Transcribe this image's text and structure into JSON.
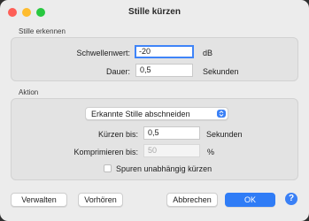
{
  "window": {
    "title": "Stille kürzen"
  },
  "detect": {
    "section_label": "Stille erkennen",
    "threshold_label": "Schwellenwert:",
    "threshold_value": "-20",
    "threshold_unit": "dB",
    "duration_label": "Dauer:",
    "duration_value": "0,5",
    "duration_unit": "Sekunden"
  },
  "action": {
    "section_label": "Aktion",
    "mode_selected": "Erkannte Stille abschneiden",
    "truncate_label": "Kürzen bis:",
    "truncate_value": "0,5",
    "truncate_unit": "Sekunden",
    "compress_label": "Komprimieren bis:",
    "compress_value": "50",
    "compress_unit": "%",
    "independent_label": "Spuren unabhängig kürzen",
    "independent_checked": false
  },
  "buttons": {
    "manage": "Verwalten",
    "preview": "Vorhören",
    "cancel": "Abbrechen",
    "ok": "OK",
    "help": "?"
  },
  "colors": {
    "accent": "#2f7cf6",
    "close": "#fe5f57",
    "minimize": "#febc2e",
    "maximize": "#28c840"
  }
}
